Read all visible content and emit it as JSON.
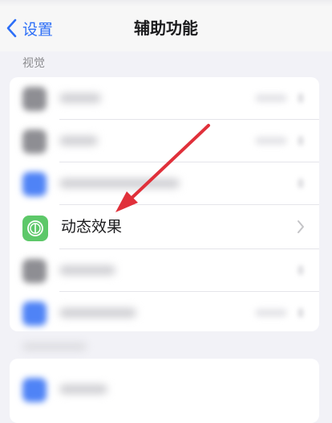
{
  "nav": {
    "back_label": "设置",
    "title": "辅助功能"
  },
  "section": {
    "header": "视觉"
  },
  "focused_row": {
    "label": "动态效果",
    "icon": "motion-icon"
  },
  "blurred_rows": [
    {
      "icon_color": "#8e8e93"
    },
    {
      "icon_color": "#8e8e93"
    },
    {
      "icon_color": "#4f83f6"
    },
    {
      "icon_color": "#8e8e93"
    },
    {
      "icon_color": "#4f83f6"
    }
  ],
  "colors": {
    "accent": "#2d6ff7",
    "motion_icon_green": "#5dc869",
    "annotation_arrow": "#e0303a",
    "background": "#f2f2f7"
  }
}
